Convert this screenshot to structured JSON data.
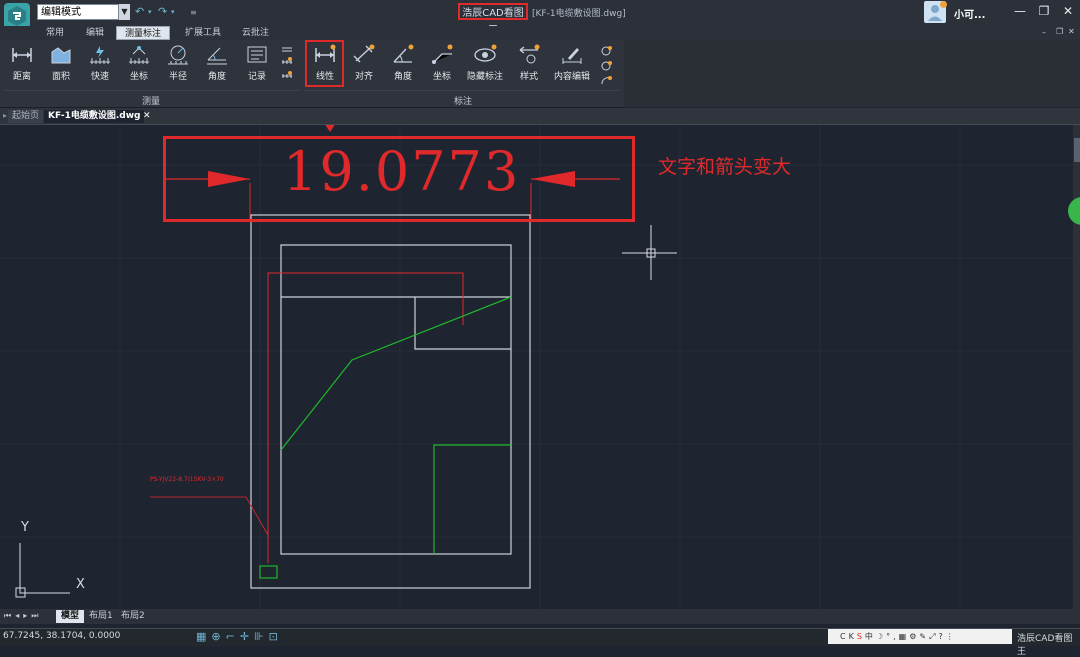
{
  "titlebar": {
    "mode_select": "编辑模式",
    "app_title": "浩辰CAD看图王",
    "file_title": "[KF-1电缆敷设图.dwg]",
    "user_name": "小可..."
  },
  "menu_tabs": [
    {
      "label": "常用"
    },
    {
      "label": "编辑"
    },
    {
      "label": "测量标注"
    },
    {
      "label": "扩展工具"
    },
    {
      "label": "云批注"
    }
  ],
  "ribbon": {
    "measure_buttons": [
      {
        "label": "距离",
        "icon": "distance-icon"
      },
      {
        "label": "面积",
        "icon": "area-icon"
      },
      {
        "label": "快速",
        "icon": "quick-icon"
      },
      {
        "label": "坐标",
        "icon": "coordinate-icon"
      },
      {
        "label": "半径",
        "icon": "radius-icon"
      },
      {
        "label": "角度",
        "icon": "angle-icon"
      },
      {
        "label": "记录",
        "icon": "record-icon"
      }
    ],
    "annotate_buttons": [
      {
        "label": "线性",
        "icon": "linear-dim-icon"
      },
      {
        "label": "对齐",
        "icon": "aligned-dim-icon"
      },
      {
        "label": "角度",
        "icon": "angle-dim-icon"
      },
      {
        "label": "坐标",
        "icon": "coord-dim-icon"
      },
      {
        "label": "隐藏标注",
        "icon": "hide-dim-icon"
      },
      {
        "label": "样式",
        "icon": "style-icon"
      },
      {
        "label": "内容编辑",
        "icon": "edit-content-icon"
      }
    ],
    "group_measure": "测量",
    "group_annotate": "标注"
  },
  "doc_tabs": [
    {
      "label": "起始页"
    },
    {
      "label": "KF-1电缆敷设图.dwg"
    }
  ],
  "drawing": {
    "dimension_value": "19.0773",
    "annotation_note": "文字和箭头变大",
    "small_label": "PS-YJV22-8.7/15KV-3×70",
    "axis_x": "X",
    "axis_y": "Y"
  },
  "layout_tabs": [
    {
      "label": "模型"
    },
    {
      "label": "布局1"
    },
    {
      "label": "布局2"
    }
  ],
  "status": {
    "coordinates": "67.7245, 38.1704, 0.0000",
    "app_name": "浩辰CAD看图王"
  },
  "colors": {
    "highlight_red": "#e0292b",
    "canvas_bg": "#1f2431",
    "green_line": "#1fb82a"
  }
}
